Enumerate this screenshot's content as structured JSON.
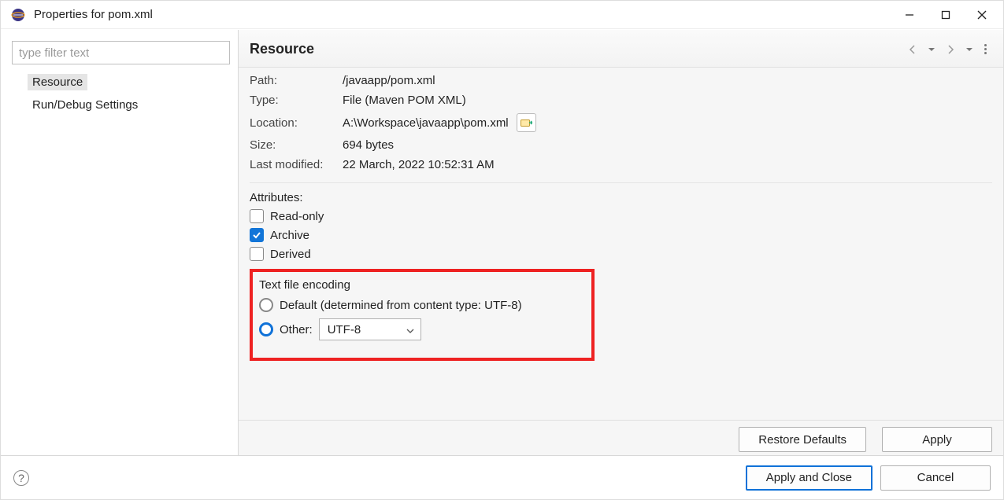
{
  "window": {
    "title": "Properties for pom.xml"
  },
  "sidebar": {
    "filter_placeholder": "type filter text",
    "items": [
      {
        "label": "Resource",
        "selected": true
      },
      {
        "label": "Run/Debug Settings",
        "selected": false
      }
    ]
  },
  "header": {
    "title": "Resource"
  },
  "resource": {
    "labels": {
      "path": "Path:",
      "type": "Type:",
      "location": "Location:",
      "size": "Size:",
      "last_modified": "Last modified:"
    },
    "path": "/javaapp/pom.xml",
    "type": "File  (Maven POM XML)",
    "location": "A:\\Workspace\\javaapp\\pom.xml",
    "size": "694  bytes",
    "last_modified": "22 March, 2022 10:52:31 AM"
  },
  "attributes": {
    "section_label": "Attributes:",
    "read_only": {
      "label": "Read-only",
      "checked": false
    },
    "archive": {
      "label": "Archive",
      "checked": true
    },
    "derived": {
      "label": "Derived",
      "checked": false
    }
  },
  "encoding": {
    "section_label": "Text file encoding",
    "default_label": "Default (determined from content type: UTF-8)",
    "other_label": "Other:",
    "selected": "other",
    "other_value": "UTF-8"
  },
  "buttons": {
    "restore_defaults": "Restore Defaults",
    "apply": "Apply",
    "apply_and_close": "Apply and Close",
    "cancel": "Cancel"
  }
}
